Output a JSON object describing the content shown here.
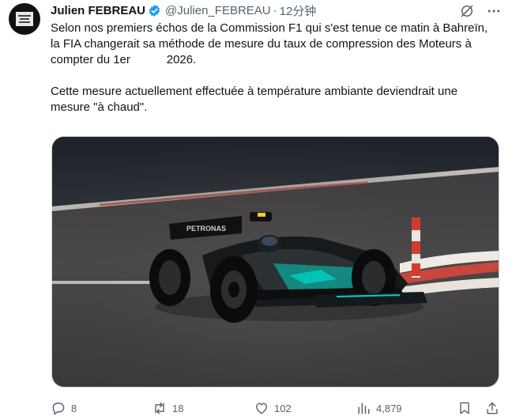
{
  "tweet": {
    "author_name": "Julien FEBREAU",
    "handle": "@Julien_FEBREAU",
    "separator": "·",
    "time": "12分钟",
    "text": "Selon nos premiers échos de la Commission F1 qui s'est tenue ce matin à Bahreïn, la FIA changerait sa méthode de mesure du taux de compression des Moteurs à compter du 1er           2026.\n\nCette mesure actuellement effectuée à température ambiante deviendrait une mesure \"à chaud\".",
    "image": {
      "car_livery": "PETRONAS",
      "icons": [
        "f1-car",
        "track-kerb",
        "bollard"
      ]
    }
  },
  "stats": {
    "replies": "8",
    "reposts": "18",
    "likes": "102",
    "views": "4,879"
  },
  "icons": [
    "verified-badge-icon",
    "grok-icon",
    "more-icon",
    "reply-icon",
    "repost-icon",
    "like-icon",
    "views-icon",
    "bookmark-icon",
    "share-icon"
  ],
  "colors": {
    "verified": "#1d9bf0",
    "muted": "#536471",
    "text": "#0f1419",
    "car_teal": "#00d2be"
  }
}
